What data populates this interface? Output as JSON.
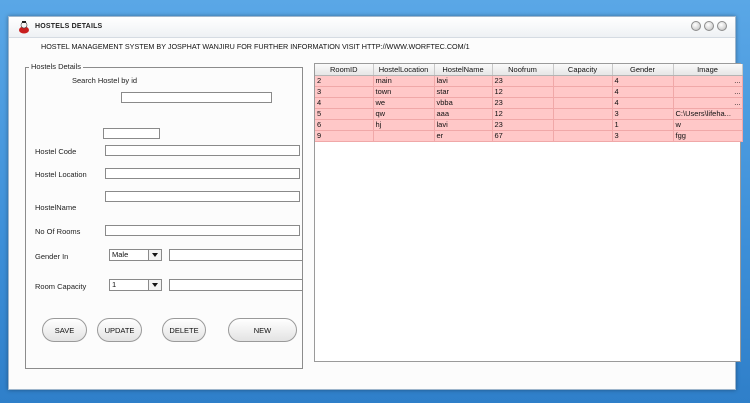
{
  "window": {
    "title": "HOSTELS DETAILS",
    "header": "HOSTEL MANAGEMENT SYSTEM BY JOSPHAT WANJIRU  FOR FURTHER INFORMATION VISIT HTTP://WWW.WORFTEC.COM/1"
  },
  "form": {
    "legend": "Hostels Details",
    "search_label": "Search Hostel by id",
    "search_value": "",
    "id_value": "",
    "hostel_code_label": "Hostel Code",
    "hostel_code_value": "",
    "hostel_location_label": "Hostel Location",
    "hostel_location_value": "",
    "hostel_name_label": "HostelName",
    "hostel_name_value": "",
    "no_rooms_label": "No Of Rooms",
    "no_rooms_value": "",
    "gender_label": "Gender In",
    "gender_selected": "Male",
    "gender_extra": "",
    "capacity_label": "Room Capacity",
    "capacity_selected": "1",
    "capacity_extra": ""
  },
  "buttons": {
    "save": "SAVE",
    "update": "UPDATE",
    "delete": "DELETE",
    "new": "NEW"
  },
  "table": {
    "columns": [
      "RoomID",
      "HostelLocation",
      "HostelName",
      "Noofrum",
      "Capacity",
      "Gender",
      "Image"
    ],
    "rows": [
      [
        "2",
        "main",
        "lavi",
        "23",
        "",
        "4",
        "..."
      ],
      [
        "3",
        "town",
        "star",
        "12",
        "",
        "4",
        "..."
      ],
      [
        "4",
        "we",
        "vbba",
        "23",
        "",
        "4",
        "..."
      ],
      [
        "5",
        "qw",
        "aaa",
        "12",
        "",
        "3",
        "C:\\Users\\lifeha..."
      ],
      [
        "6",
        "hj",
        "lavi",
        "23",
        "",
        "1",
        "w"
      ],
      [
        "9",
        "",
        "er",
        "67",
        "",
        "3",
        "fgg"
      ]
    ]
  },
  "colors": {
    "row_bg": "#ffc8c8",
    "desktop": "#3d8fd8"
  }
}
